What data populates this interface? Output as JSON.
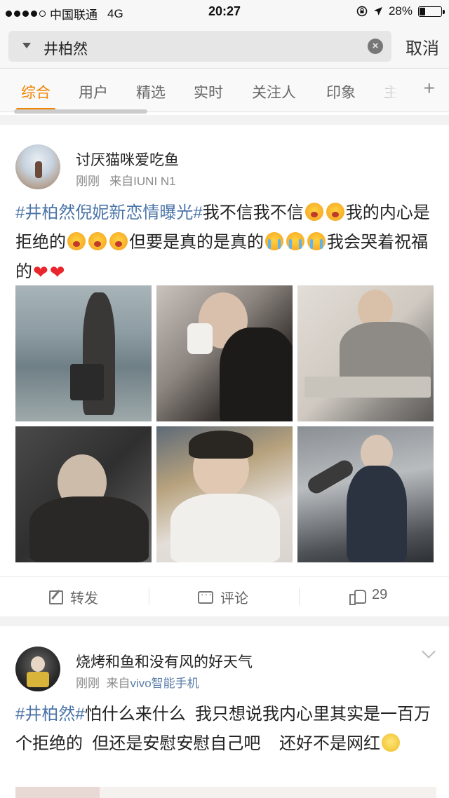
{
  "status_bar": {
    "carrier": "中国联通",
    "network": "4G",
    "time": "20:27",
    "battery": "28%",
    "battery_level": 0.28
  },
  "search": {
    "query": "井柏然",
    "cancel_label": "取消"
  },
  "tabs": [
    {
      "label": "综合",
      "active": true
    },
    {
      "label": "用户"
    },
    {
      "label": "精选"
    },
    {
      "label": "实时"
    },
    {
      "label": "关注人"
    },
    {
      "label": "印象"
    },
    {
      "label": "主"
    }
  ],
  "tab_add": "+",
  "posts": [
    {
      "username": "讨厌猫咪爱吃鱼",
      "time": "刚刚",
      "source": "来自IUNI N1",
      "text": {
        "hashtag": "#井柏然倪妮新恋情曝光#",
        "part1": "我不信我不信",
        "part2": "我的内心是拒绝的",
        "part3": "但要是真的是真的",
        "part4": "我会哭着祝福的"
      },
      "actions": {
        "repost": "转发",
        "comment": "评论",
        "likes": "29"
      }
    },
    {
      "username": "烧烤和鱼和没有风的好天气",
      "time": "刚刚",
      "source_prefix": "来自",
      "source_device": "vivo智能手机",
      "text": {
        "hashtag": "#井柏然#",
        "body": "怕什么来什么  我只想说我内心里其实是一百万个拒绝的  但还是安慰安慰自己吧    还好不是网红"
      }
    }
  ],
  "colors": {
    "accent": "#f08300",
    "hashtag": "#4a74a8",
    "heart": "#e8262b"
  }
}
